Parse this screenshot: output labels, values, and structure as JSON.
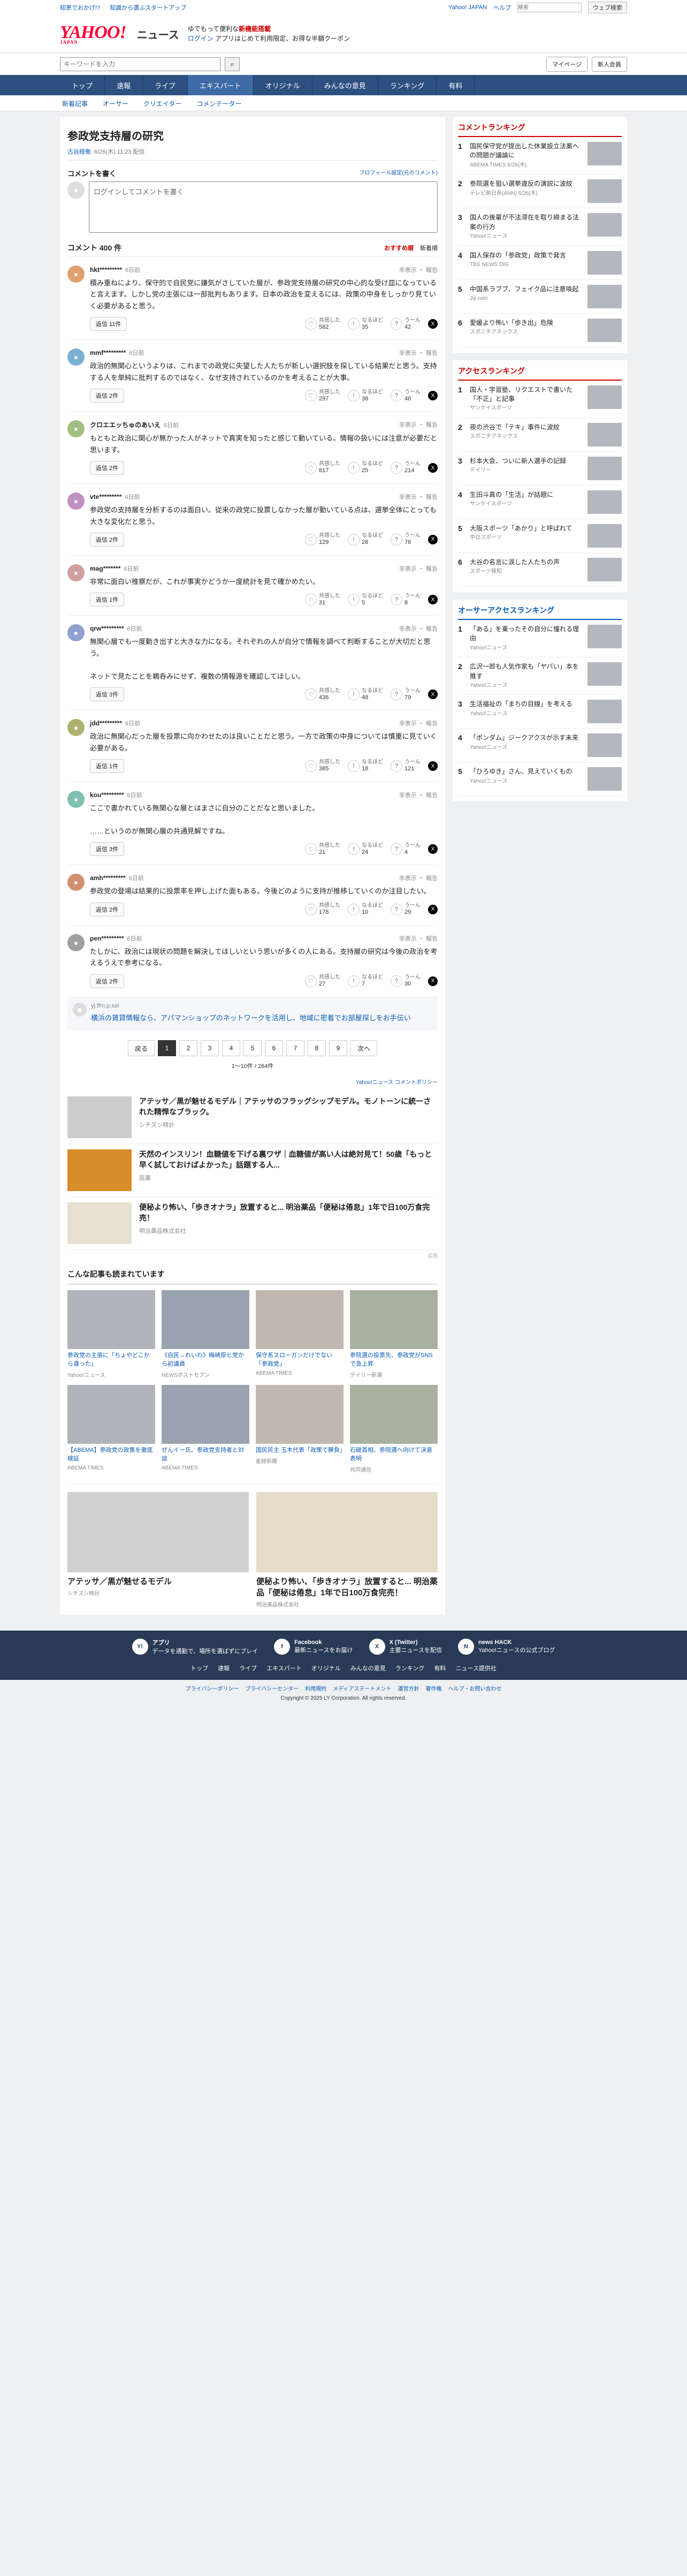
{
  "topstrip": {
    "left1": "知恵でおかげ!?",
    "left2": "知識から選ぶスタートアップ",
    "links": [
      "Yahoo! JAPAN",
      "ヘルプ"
    ],
    "search_placeholder": "検索",
    "search_btn": "ウェブ検索"
  },
  "header": {
    "logo": "YAHOO!",
    "logo_sub": "JAPAN",
    "service": "ニュース",
    "msg1": "ゆでもって便利な",
    "msg_bold": "新機能搭載",
    "msg2": "アプリはじめて利用限定、お得な半額クーポン",
    "login": "ログイン"
  },
  "searchbar": {
    "placeholder": "キーワードを入力",
    "mypage": "マイページ",
    "signup": "新人会員"
  },
  "nav": {
    "tabs": [
      "トップ",
      "速報",
      "ライブ",
      "エキスパート",
      "オリジナル",
      "みんなの意見",
      "ランキング",
      "有料"
    ],
    "active": 3
  },
  "subnav": [
    "新着記事",
    "オーサー",
    "クリエイター",
    "コメンテーター"
  ],
  "article": {
    "title": "参政党支持層の研究",
    "author": "古谷経衡",
    "date": "6/26(木) 11:23 配信"
  },
  "postbox": {
    "heading": "コメントを書く",
    "guide": "プロフィール設定(元のコメント)",
    "placeholder": "ログインしてコメントを書く"
  },
  "comments_head": {
    "count": "コメント 400 件",
    "sort_options": [
      "おすすめ順",
      "新着順"
    ],
    "active": 0
  },
  "comments": [
    {
      "user": "hkt*********",
      "time": "6日前",
      "report": "非表示 ・ 報告",
      "text": "積み重ねにより、保守的で自民党に嫌気がさしていた層が、参政党支持層の研究の中心的な受け皿になっていると言えます。しかし党の主張には一部批判もあります。日本の政治を変えるには、政策の中身をしっかり見ていく必要があると思う。",
      "reply": "返信 11件",
      "agree": "共感した",
      "agree_n": "582",
      "think": "なるほど",
      "think_n": "35",
      "hmm": "うーん",
      "hmm_n": "42"
    },
    {
      "user": "mmf*********",
      "time": "6日前",
      "report": "非表示 ・ 報告",
      "text": "政治的無関心というよりは、これまでの政党に失望した人たちが新しい選択肢を探している結果だと思う。支持する人を単純に批判するのではなく、なぜ支持されているのかを考えることが大事。",
      "reply": "返信 2件",
      "agree": "共感した",
      "agree_n": "297",
      "think": "なるほど",
      "think_n": "38",
      "hmm": "うーん",
      "hmm_n": "46"
    },
    {
      "user": "クロエエッちゅのあいえ",
      "time": "6日前",
      "report": "非表示 ・ 報告",
      "text": "もともと政治に関心が無かった人がネットで真実を知ったと感じて動いている。情報の扱いには注意が必要だと思います。",
      "reply": "返信 2件",
      "agree": "共感した",
      "agree_n": "817",
      "think": "なるほど",
      "think_n": "25",
      "hmm": "うーん",
      "hmm_n": "214"
    },
    {
      "user": "vte*********",
      "time": "6日前",
      "report": "非表示 ・ 報告",
      "text": "参政党の支持層を分析するのは面白い。従来の政党に投票しなかった層が動いている点は、選挙全体にとっても大きな変化だと思う。",
      "reply": "返信 2件",
      "agree": "共感した",
      "agree_n": "129",
      "think": "なるほど",
      "think_n": "28",
      "hmm": "うーん",
      "hmm_n": "76"
    },
    {
      "user": "mag*******",
      "time": "6日前",
      "report": "非表示 ・ 報告",
      "text": "非常に面白い推察だが、これが事実かどうか一度統計を見て確かめたい。",
      "reply": "返信 1件",
      "agree": "共感した",
      "agree_n": "31",
      "think": "なるほど",
      "think_n": "5",
      "hmm": "うーん",
      "hmm_n": "8"
    },
    {
      "user": "qrw*********",
      "time": "6日前",
      "report": "非表示 ・ 報告",
      "text": "無関心層でも一度動き出すと大きな力になる。それぞれの人が自分で情報を調べて判断することが大切だと思う。\n\nネットで見たことを鵜呑みにせず、複数の情報源を確認してほしい。",
      "reply": "返信 3件",
      "agree": "共感した",
      "agree_n": "436",
      "think": "なるほど",
      "think_n": "48",
      "hmm": "うーん",
      "hmm_n": "79"
    },
    {
      "user": "jdd*********",
      "time": "6日前",
      "report": "非表示 ・ 報告",
      "text": "政治に無関心だった層を投票に向かわせたのは良いことだと思う。一方で政策の中身については慎重に見ていく必要がある。",
      "reply": "返信 1件",
      "agree": "共感した",
      "agree_n": "385",
      "think": "なるほど",
      "think_n": "18",
      "hmm": "うーん",
      "hmm_n": "121"
    },
    {
      "user": "kou*********",
      "time": "6日前",
      "report": "非表示 ・ 報告",
      "text": "ここで書かれている無関心な層とはまさに自分のことだなと思いました。\n\n……というのが無関心層の共通見解ですね。",
      "reply": "返信 3件",
      "agree": "共感した",
      "agree_n": "21",
      "think": "なるほど",
      "think_n": "24",
      "hmm": "うーん",
      "hmm_n": "4"
    },
    {
      "user": "amh*********",
      "time": "6日前",
      "report": "非表示 ・ 報告",
      "text": "参政党の登場は結果的に投票率を押し上げた面もある。今後どのように支持が推移していくのか注目したい。",
      "reply": "返信 2件",
      "agree": "共感した",
      "agree_n": "178",
      "think": "なるほど",
      "think_n": "10",
      "hmm": "うーん",
      "hmm_n": "29"
    },
    {
      "user": "pen*********",
      "time": "6日前",
      "report": "非表示 ・ 報告",
      "text": "たしかに、政治には現状の問題を解決してほしいという思いが多くの人にある。支持層の研究は今後の政治を考えるうえで参考になる。",
      "reply": "返信 2件",
      "agree": "共感した",
      "agree_n": "27",
      "think": "なるほど",
      "think_n": "7",
      "hmm": "うーん",
      "hmm_n": "30"
    }
  ],
  "alert": {
    "user": "yj.ffm.p.sal",
    "text": "横浜の賃貸情報なら、アパマンショップのネットワークを活用し、地域に密着でお部屋探しをお手伝い"
  },
  "pager": {
    "prev": "戻る",
    "pages": [
      "1",
      "2",
      "3",
      "4",
      "5",
      "6",
      "7",
      "8",
      "9"
    ],
    "next": "次へ",
    "active": 0,
    "count": "1〜10件 / 264件"
  },
  "policy": "Yahoo!ニュース コメントポリシー",
  "ads": [
    {
      "title": "アテッサ／黒が魅せるモデル｜アテッサのフラッグシップモデル。モノトーンに統一された精悍なブラック。",
      "src": "シチズン時計"
    },
    {
      "title": "天然のインスリン！血糖値を下げる裏ワザ｜血糖値が高い人は絶対見て！50歳「もっと早く試しておけばよかった」話題する人...",
      "src": "医薬"
    },
    {
      "title": "便秘より怖い、「歩きオナラ」放置すると... 明治薬品「便秘は倦怠」1年で日100万食完売！",
      "src": "明治薬品株式会社"
    }
  ],
  "ad_flag": "広告",
  "rec": {
    "heading": "こんな記事も読まれています",
    "items": [
      {
        "t": "参政党の主張に「ちょやどこから違った」",
        "s": "Yahoo!ニュース"
      },
      {
        "t": "《自民→れいわ》梅崎原ヒ党から初議員",
        "s": "NEWSポストセブン"
      },
      {
        "t": "保守系スローガンだけでない「参政党」",
        "s": "ABEMA TIMES"
      },
      {
        "t": "参院選の投票先、参政党がSNSで急上昇",
        "s": "デイリー新潮"
      },
      {
        "t": "【ABEMA】参政党の政策を徹底検証",
        "s": "ABEMA TIMES"
      },
      {
        "t": "ぜんイー氏、参政党支持者と対談",
        "s": "ABEMA TIMES"
      },
      {
        "t": "国民民主 玉木代表「政策で勝負」",
        "s": "産経新聞"
      },
      {
        "t": "石破首相、参院選へ向けて決意表明",
        "s": "共同通信"
      }
    ]
  },
  "adbig": [
    {
      "t": "アテッサ／黒が魅せるモデル",
      "s": "シチズン時計"
    },
    {
      "t": "便秘より怖い、「歩きオナラ」放置すると... 明治薬品「便秘は倦怠」1年で日100万食完売！",
      "s": "明治薬品株式会社"
    }
  ],
  "side_ranking": {
    "title": "コメントランキング",
    "items": [
      {
        "no": "1",
        "t": "国民保守党が提出した休業設立法案への問題が議論に",
        "s": "ABEMA TIMES 6/26(木)"
      },
      {
        "no": "2",
        "t": "参院選を狙い選挙違反の演説に波紋",
        "s": "テレビ朝日系(ANN) 6/26(木)"
      },
      {
        "no": "3",
        "t": "国人の後輩が不法滞在を取り締まる法案の行方",
        "s": "Yahoo!ニュース"
      },
      {
        "no": "4",
        "t": "国人保存の「参政党」政策で発言",
        "s": "TBS NEWS DIG"
      },
      {
        "no": "5",
        "t": "中国系ラブブ、フェイク品に注意喚起",
        "s": "Jiji.com"
      },
      {
        "no": "6",
        "t": "愛媛より怖い「歩き出」危険",
        "s": "スポニチアネックス"
      }
    ]
  },
  "side_access": {
    "title": "アクセスランキング",
    "items": [
      {
        "no": "1",
        "t": "国人・学習塾、リクエストで書いた「不正」と記事",
        "s": "サンケイスポーツ"
      },
      {
        "no": "2",
        "t": "夜の渋谷で「テキ」事件に波紋",
        "s": "スポニチアネックス"
      },
      {
        "no": "3",
        "t": "杉本大会、ついに新人選手の記録",
        "s": "デイリー"
      },
      {
        "no": "4",
        "t": "生田斗真の「生活」が話題に",
        "s": "サンケイスポーツ"
      },
      {
        "no": "5",
        "t": "大阪スポーツ「あかり」と呼ばれて",
        "s": "中日スポーツ"
      },
      {
        "no": "6",
        "t": "大谷の名言に涙した人たちの声",
        "s": "スポーツ報知"
      }
    ]
  },
  "side_creator": {
    "title": "オーサーアクセスランキング",
    "items": [
      {
        "no": "1",
        "t": "「ある」を乗ったその自分に憧れる理由",
        "s": "Yahoo!ニュース"
      },
      {
        "no": "2",
        "t": "広沢一郎も人気作家も「ヤバい」本を推す",
        "s": "Yahoo!ニュース"
      },
      {
        "no": "3",
        "t": "生活福祉の「まちの目線」を考える",
        "s": "Yahoo!ニュース"
      },
      {
        "no": "4",
        "t": "「ポンダム」ジークアクスが示す未来",
        "s": "Yahoo!ニュース"
      },
      {
        "no": "5",
        "t": "「ひろゆき」さん、見えていくもの",
        "s": "Yahoo!ニュース"
      }
    ]
  },
  "footer": {
    "apps": [
      {
        "icon": "Y!",
        "t": "アプリ",
        "s": "データを通勤で、場所を選ばずにプレイ"
      },
      {
        "icon": "f",
        "t": "Facebook",
        "s": "最新ニュースをお届け"
      },
      {
        "icon": "X",
        "t": "X (Twitter)",
        "s": "主要ニュースを配信"
      },
      {
        "icon": "N",
        "t": "news HACK",
        "s": "Yahoo!ニュースの公式ブログ"
      }
    ],
    "links": [
      "トップ",
      "速報",
      "ライブ",
      "エキスパート",
      "オリジナル",
      "みんなの意見",
      "ランキング",
      "有料",
      "ニュース提供社"
    ]
  },
  "bottom": {
    "links": [
      "プライバシーポリシー",
      "プライバシーセンター",
      "利用規約",
      "メディアステートメント",
      "運営方針",
      "著作権",
      "ヘルプ・お問い合わせ"
    ],
    "copy": "Copyright © 2025 LY Corporation. All rights reserved."
  }
}
